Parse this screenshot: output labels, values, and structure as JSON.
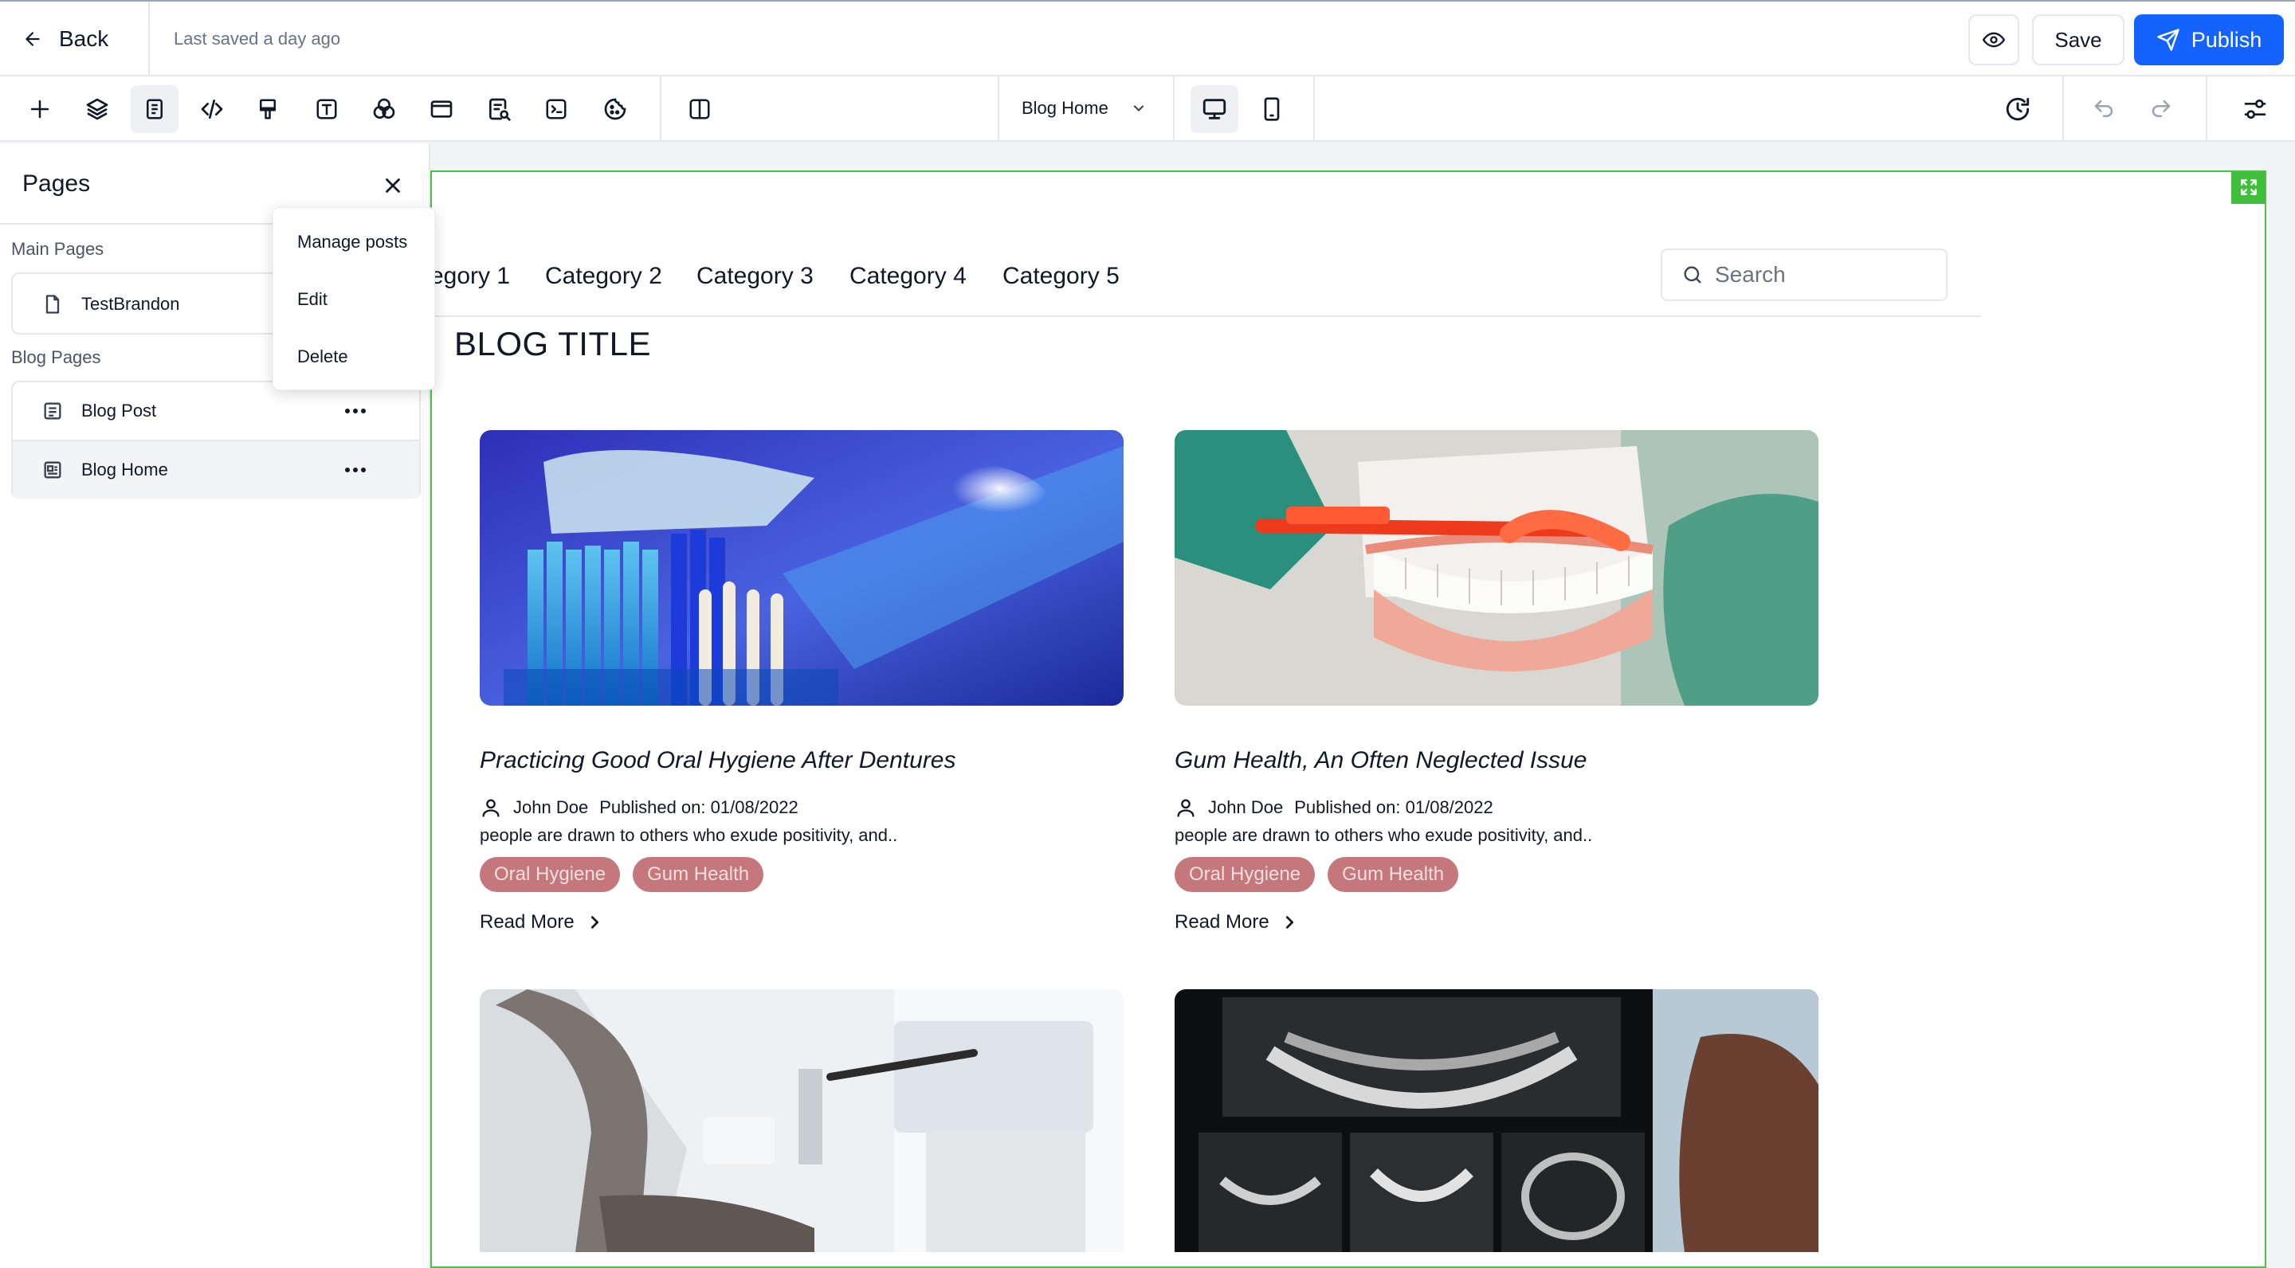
{
  "header": {
    "back_label": "Back",
    "saved_text": "Last saved a day ago",
    "save_label": "Save",
    "publish_label": "Publish"
  },
  "toolbar": {
    "page_select_value": "Blog Home"
  },
  "panel": {
    "title": "Pages",
    "main_section": "Main Pages",
    "main_pages": [
      "TestBrandon"
    ],
    "blog_section": "Blog Pages",
    "blog_pages": [
      "Blog Post",
      "Blog Home"
    ]
  },
  "context_menu": {
    "items": [
      "Manage posts",
      "Edit",
      "Delete"
    ]
  },
  "canvas": {
    "nav": [
      "egory 1",
      "Category 2",
      "Category 3",
      "Category 4",
      "Category 5"
    ],
    "search_placeholder": "Search",
    "blog_title": "BLOG TITLE",
    "posts": [
      {
        "title": "Practicing Good Oral Hygiene After Dentures",
        "author": "John Doe",
        "published": "Published on: 01/08/2022",
        "excerpt": "people are drawn to others who exude positivity, and..",
        "tags": [
          "Oral Hygiene",
          "Gum Health"
        ],
        "read_more": "Read More"
      },
      {
        "title": "Gum Health, An Often Neglected Issue",
        "author": "John Doe",
        "published": "Published on: 01/08/2022",
        "excerpt": "people are drawn to others who exude positivity, and..",
        "tags": [
          "Oral Hygiene",
          "Gum Health"
        ],
        "read_more": "Read More"
      }
    ]
  },
  "colors": {
    "accent": "#1463ff",
    "selection": "#4cc048",
    "tag_bg": "#c4787c"
  }
}
